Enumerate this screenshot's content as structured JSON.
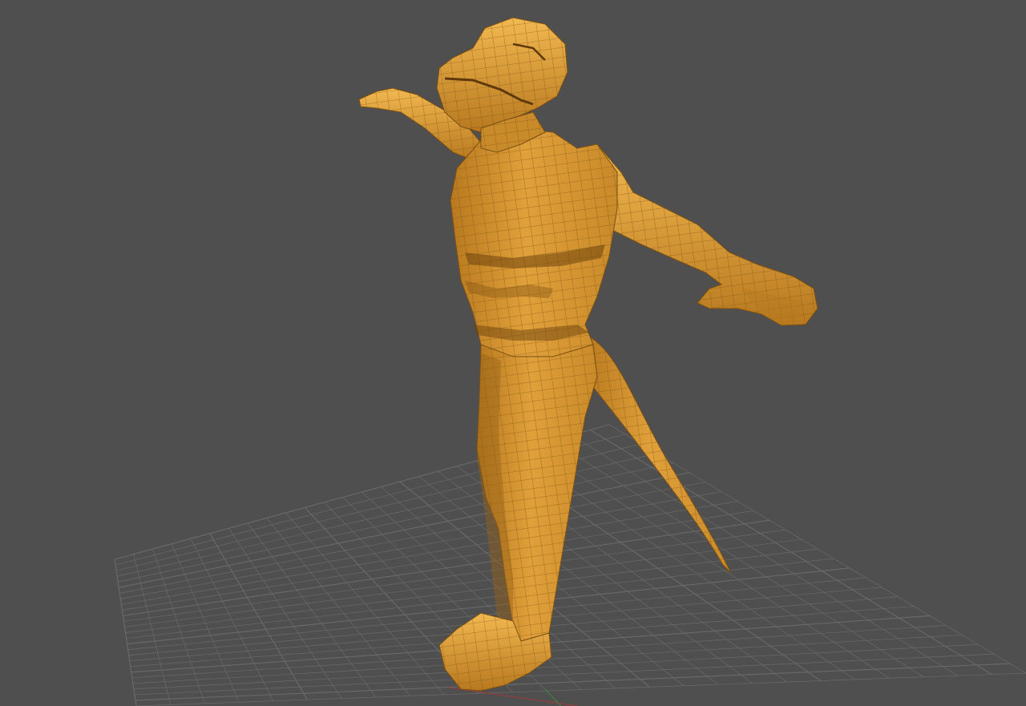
{
  "viewport": {
    "background_color": "#4f4f4f",
    "grid_color": "#6a6a6a",
    "grid_visible": true,
    "mesh_color": "#e0a03a",
    "mesh_shadow_color": "#b8791f",
    "mesh_highlight_color": "#f2b850",
    "wire_color": "#7a4f12",
    "axis_x_color": "#a03a3a",
    "axis_y_color": "#3a8a3a"
  }
}
